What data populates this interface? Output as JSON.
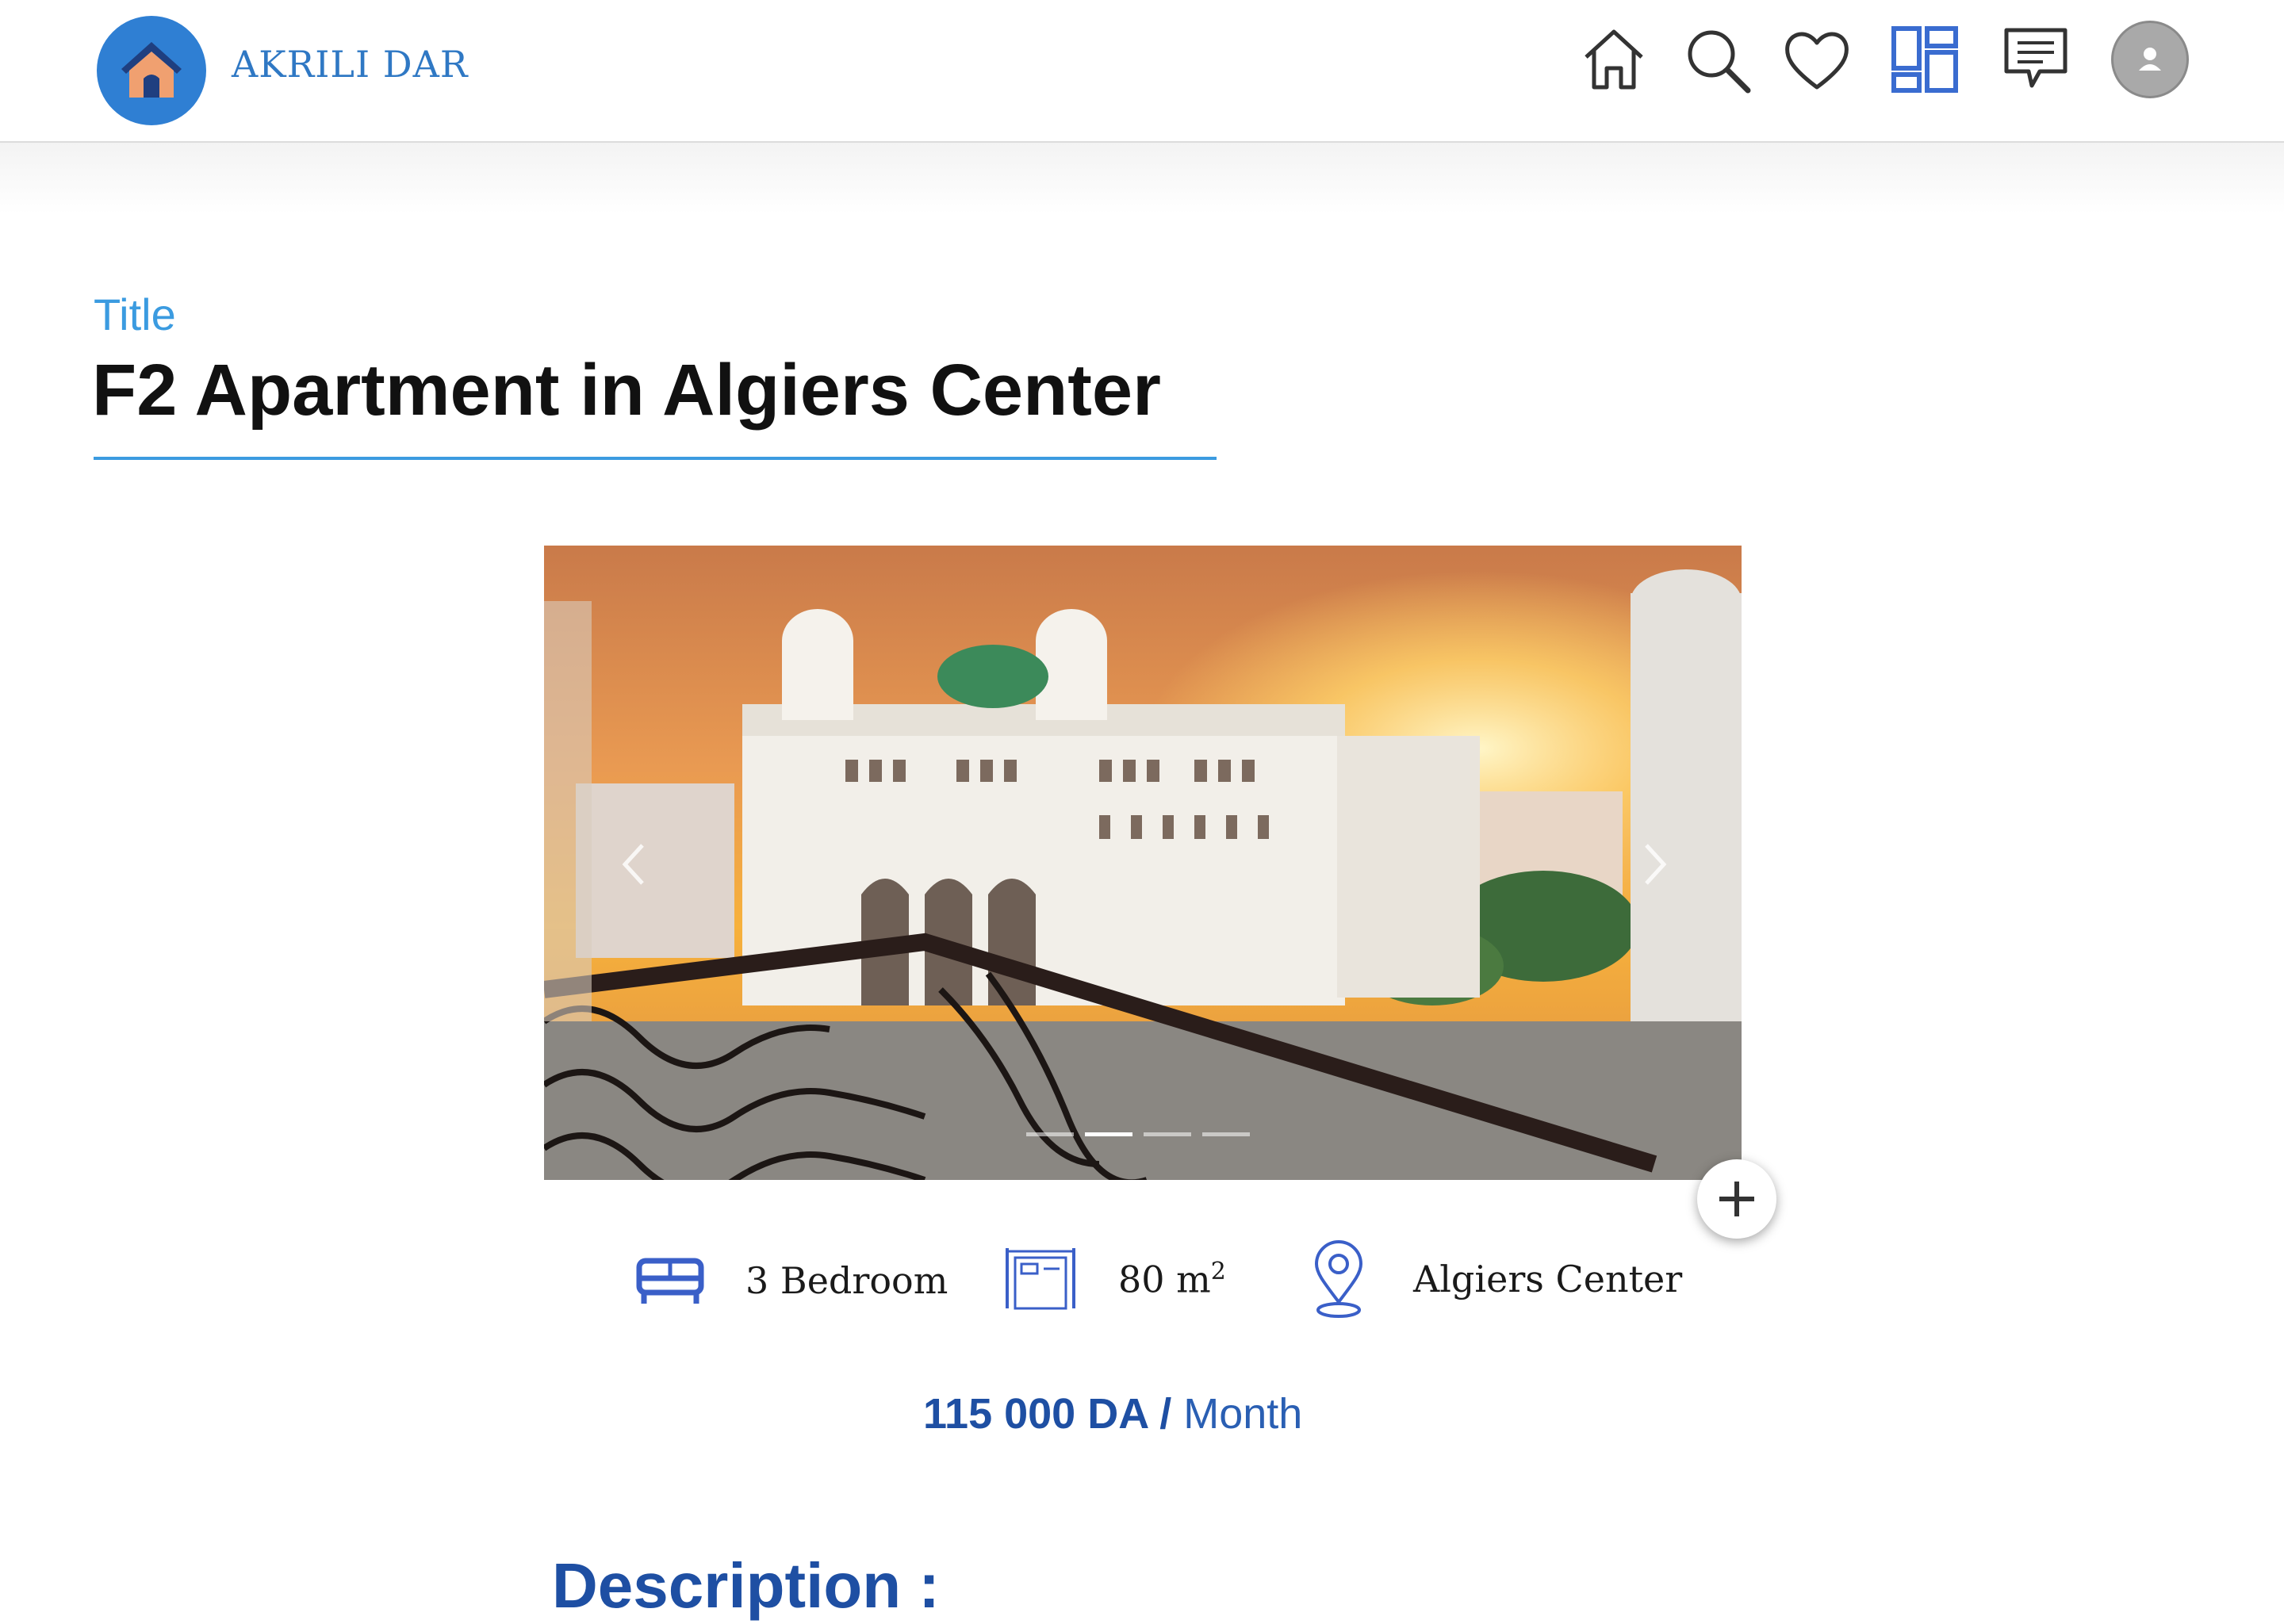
{
  "header": {
    "brand": "AKRILI DAR",
    "nav": [
      "home-icon",
      "search-icon",
      "heart-icon",
      "dashboard-icon",
      "chat-icon",
      "avatar-icon"
    ],
    "accent": "#2f78c4"
  },
  "listing": {
    "title_label": "Title",
    "title": "F2 Apartment in Algiers Center",
    "carousel": {
      "slides": 4,
      "active_slide": 2
    },
    "features": {
      "bedrooms": "3 Bedroom",
      "area_value": "80 m",
      "area_unit_sup": "2",
      "location": "Algiers Center"
    },
    "price_amount": "115 000 DA",
    "price_separator": " / ",
    "price_period": "Month",
    "description_heading": "Description :"
  },
  "colors": {
    "title_blue": "#3b9be0",
    "price_blue": "#1e4fa3",
    "icon_blue": "#3a5fc8"
  }
}
